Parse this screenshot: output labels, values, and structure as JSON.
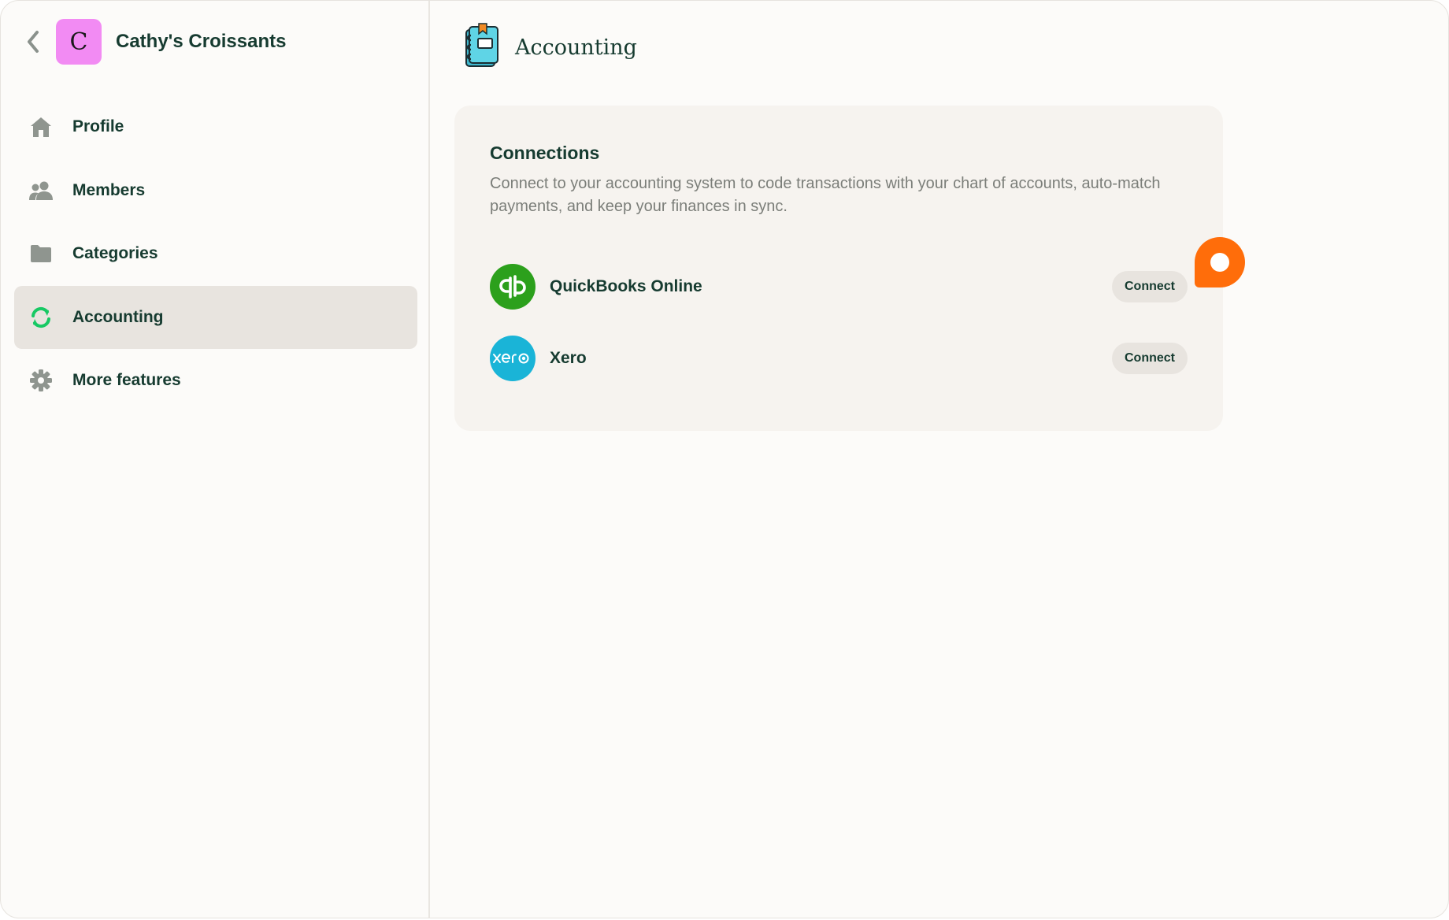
{
  "org": {
    "initial": "C",
    "name": "Cathy's Croissants"
  },
  "nav": [
    {
      "label": "Profile",
      "icon": "home-icon"
    },
    {
      "label": "Members",
      "icon": "people-icon"
    },
    {
      "label": "Categories",
      "icon": "folder-icon"
    },
    {
      "label": "Accounting",
      "icon": "sync-icon",
      "active": true
    },
    {
      "label": "More features",
      "icon": "gear-icon"
    }
  ],
  "page": {
    "title": "Accounting",
    "icon": "notebook-icon"
  },
  "connections": {
    "title": "Connections",
    "description": "Connect to your accounting system to code transactions with your chart of accounts, auto-match payments, and keep your finances in sync.",
    "items": [
      {
        "name": "QuickBooks Online",
        "logo_text": "qb",
        "logo_color": "#2ca01c",
        "button": "Connect"
      },
      {
        "name": "Xero",
        "logo_text": "xero",
        "logo_color": "#1ab4d7",
        "button": "Connect"
      }
    ]
  },
  "colors": {
    "text": "#163b30",
    "active_bg": "#e8e4df",
    "accent_green": "#17c964",
    "chat_orange": "#ff6d0a",
    "avatar_pink": "#f28bf3"
  }
}
